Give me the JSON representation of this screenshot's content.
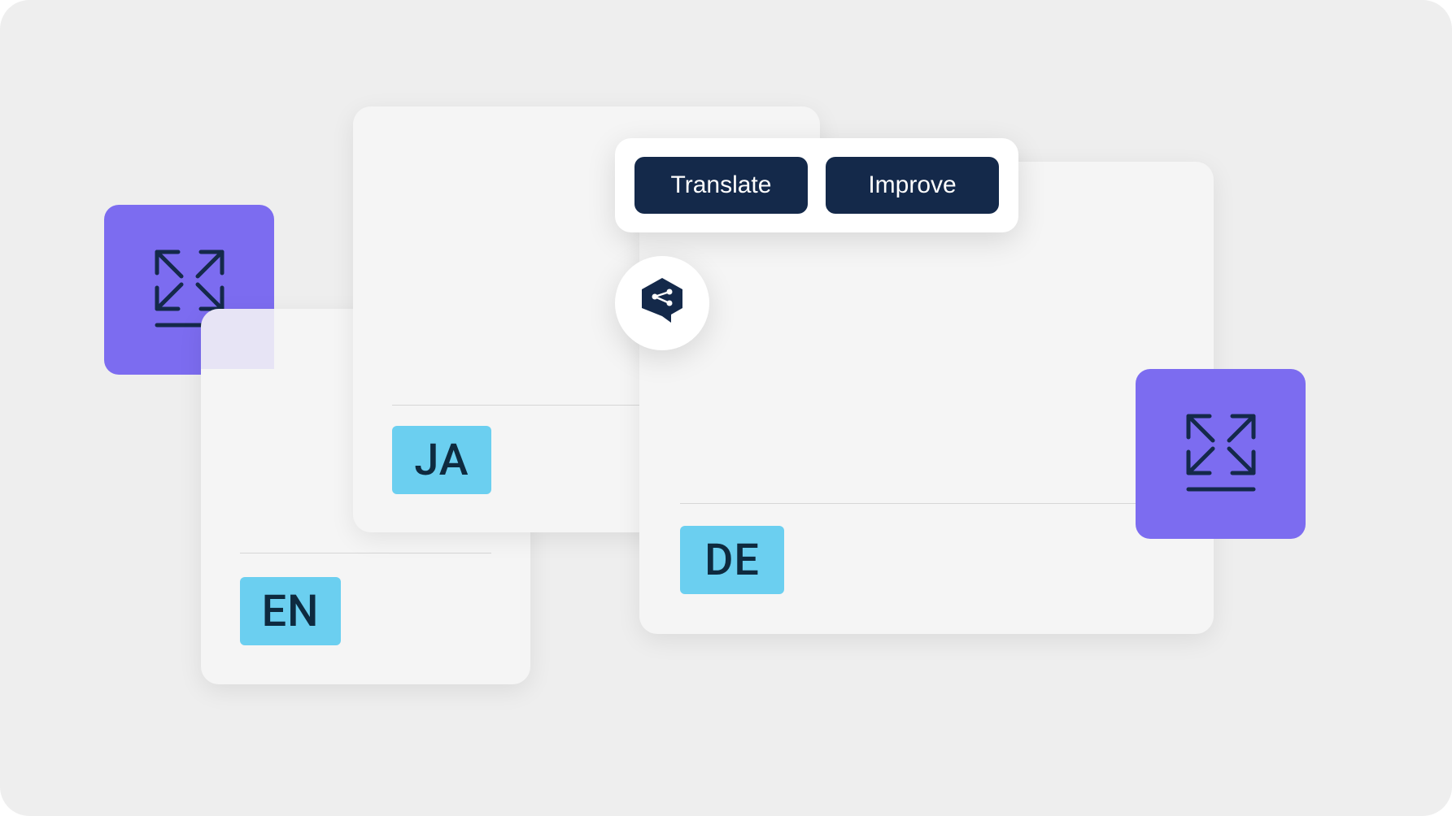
{
  "toolbar": {
    "translate_label": "Translate",
    "improve_label": "Improve"
  },
  "cards": {
    "en": {
      "language_code": "EN"
    },
    "ja": {
      "language_code": "JA"
    },
    "de": {
      "language_code": "DE"
    }
  },
  "colors": {
    "purple": "#7c6cf0",
    "cyan": "#6bcff0",
    "dark_navy": "#14294a"
  }
}
